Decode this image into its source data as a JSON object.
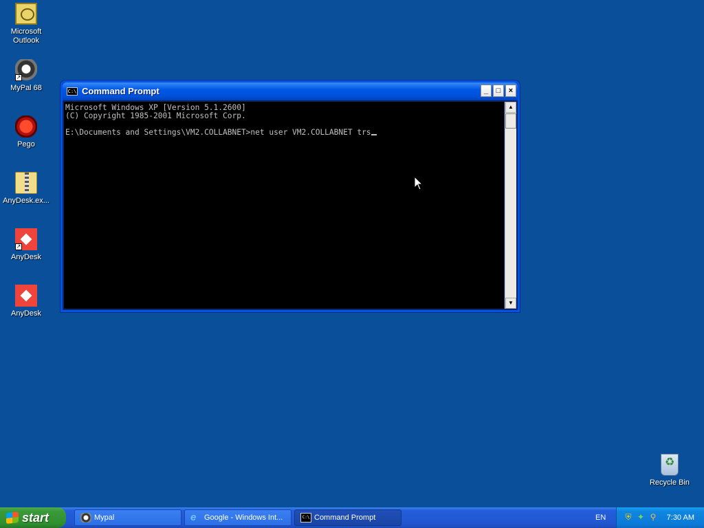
{
  "desktop": {
    "icons": [
      {
        "label": "Microsoft Outlook",
        "icon": "outlook-icon"
      },
      {
        "label": "MyPal 68",
        "icon": "mypal-icon"
      },
      {
        "label": "Pego",
        "icon": "pego-icon"
      },
      {
        "label": "AnyDesk.ex...",
        "icon": "zip-file-icon"
      },
      {
        "label": "AnyDesk",
        "icon": "anydesk-icon"
      },
      {
        "label": "AnyDesk",
        "icon": "anydesk-icon"
      },
      {
        "label": "Recycle Bin",
        "icon": "recycle-bin-icon"
      }
    ]
  },
  "window": {
    "title": "Command Prompt",
    "icon_text": "C:\\",
    "buttons": {
      "minimize": "_",
      "maximize": "□",
      "close": "×"
    },
    "console_lines": [
      "Microsoft Windows XP [Version 5.1.2600]",
      "(C) Copyright 1985-2001 Microsoft Corp.",
      "",
      "E:\\Documents and Settings\\VM2.COLLABNET>net user VM2.COLLABNET trs"
    ],
    "scroll_up": "▲",
    "scroll_down": "▼"
  },
  "taskbar": {
    "start_label": "start",
    "tasks": [
      {
        "label": "Mypal",
        "icon": "mypal-icon",
        "active": false
      },
      {
        "label": "Google - Windows Int...",
        "icon": "ie-icon",
        "active": false
      },
      {
        "label": "Command Prompt",
        "icon": "cmd-icon",
        "active": true
      }
    ],
    "language": "EN",
    "clock": "7:30 AM",
    "tray_icons": [
      "security-shield-icon",
      "network-icon",
      "search-icon"
    ]
  },
  "colors": {
    "desktop_bg": "#0a4f9a",
    "titlebar": "#0058e6",
    "start_button": "#3a9a3a",
    "console_bg": "#000000",
    "console_text": "#c0c0c0"
  }
}
